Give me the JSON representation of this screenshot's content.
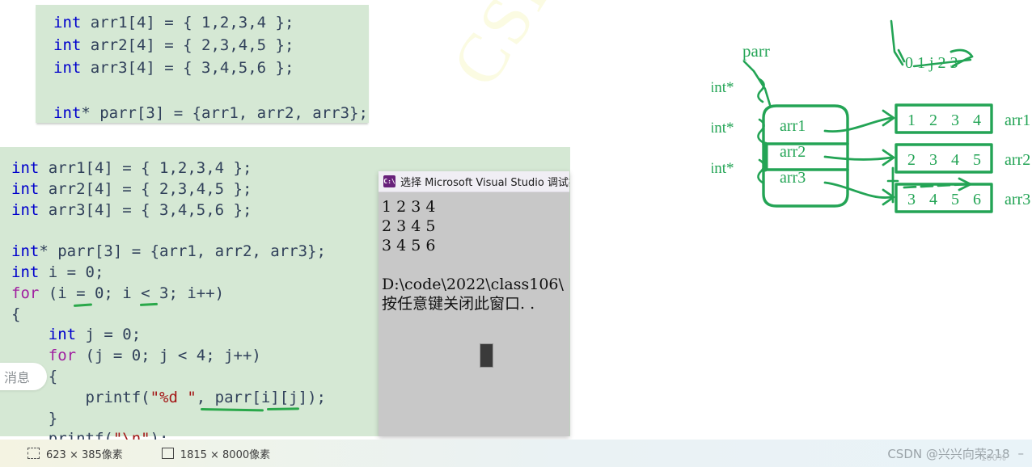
{
  "watermark": {
    "diagonal": "CSDN @兴兴向荣",
    "footer": "CSDN @兴兴向荣218",
    "zoom": "100%",
    "dash": "–"
  },
  "code_top": {
    "lines": [
      {
        "tokens": [
          {
            "t": "int",
            "c": "kw"
          },
          {
            "t": " arr1[4] = { 1,2,3,4 };",
            "c": "pl"
          }
        ]
      },
      {
        "tokens": [
          {
            "t": "int",
            "c": "kw"
          },
          {
            "t": " arr2[4] = { 2,3,4,5 };",
            "c": "pl"
          }
        ]
      },
      {
        "tokens": [
          {
            "t": "int",
            "c": "kw"
          },
          {
            "t": " arr3[4] = { 3,4,5,6 };",
            "c": "pl"
          }
        ]
      },
      {
        "tokens": [
          {
            "t": "",
            "c": "pl"
          }
        ]
      },
      {
        "tokens": [
          {
            "t": "int",
            "c": "kw"
          },
          {
            "t": "* parr[3] = {arr1, arr2, arr3};",
            "c": "pl"
          }
        ]
      }
    ]
  },
  "code_bottom": {
    "lines": [
      {
        "tokens": [
          {
            "t": "int",
            "c": "kw"
          },
          {
            "t": " arr1[4] = { 1,2,3,4 };",
            "c": "pl"
          }
        ]
      },
      {
        "tokens": [
          {
            "t": "int",
            "c": "kw"
          },
          {
            "t": " arr2[4] = { 2,3,4,5 };",
            "c": "pl"
          }
        ]
      },
      {
        "tokens": [
          {
            "t": "int",
            "c": "kw"
          },
          {
            "t": " arr3[4] = { 3,4,5,6 };",
            "c": "pl"
          }
        ]
      },
      {
        "tokens": [
          {
            "t": "",
            "c": "pl"
          }
        ]
      },
      {
        "tokens": [
          {
            "t": "int",
            "c": "kw"
          },
          {
            "t": "* parr[3] = {arr1, arr2, arr3};",
            "c": "pl"
          }
        ]
      },
      {
        "tokens": [
          {
            "t": "int",
            "c": "kw"
          },
          {
            "t": " i = 0;",
            "c": "pl"
          }
        ]
      },
      {
        "tokens": [
          {
            "t": "for",
            "c": "kwctl"
          },
          {
            "t": " (i = 0; i < 3; i++)",
            "c": "pl"
          }
        ]
      },
      {
        "tokens": [
          {
            "t": "{",
            "c": "pl"
          }
        ]
      },
      {
        "tokens": [
          {
            "t": "    ",
            "c": "pl"
          },
          {
            "t": "int",
            "c": "kw"
          },
          {
            "t": " j = 0;",
            "c": "pl"
          }
        ]
      },
      {
        "tokens": [
          {
            "t": "    ",
            "c": "pl"
          },
          {
            "t": "for",
            "c": "kwctl"
          },
          {
            "t": " (j = 0; j < 4; j++)",
            "c": "pl"
          }
        ]
      },
      {
        "tokens": [
          {
            "t": "    {",
            "c": "pl"
          }
        ]
      },
      {
        "tokens": [
          {
            "t": "        printf(",
            "c": "pl"
          },
          {
            "t": "\"%d \"",
            "c": "str"
          },
          {
            "t": ", parr[i][j]);",
            "c": "pl"
          }
        ]
      },
      {
        "tokens": [
          {
            "t": "    }",
            "c": "pl"
          }
        ]
      },
      {
        "tokens": [
          {
            "t": "    printf(",
            "c": "pl"
          },
          {
            "t": "\"\\n\"",
            "c": "str"
          },
          {
            "t": ");",
            "c": "pl"
          }
        ]
      }
    ]
  },
  "message_pill": {
    "label": "消息"
  },
  "console": {
    "title": "选择 Microsoft Visual Studio 调试控",
    "icon": "console-icon",
    "icon_glyph": "C:\\",
    "output_lines": [
      "1 2 3 4",
      "2 3 4 5",
      "3 4 5 6",
      "",
      "D:\\code\\2022\\class106\\",
      "按任意键关闭此窗口. ."
    ]
  },
  "diagram": {
    "stroke_color": "#23a455",
    "parr_label": "parr",
    "pointer_type_labels": [
      "int*",
      "int*",
      "int*"
    ],
    "parr_cells": [
      "arr1",
      "arr2",
      "arr3"
    ],
    "index_scribble": "0 1 j 2 3",
    "arrays": [
      {
        "name": "arr1",
        "values": [
          "1",
          "2",
          "3",
          "4"
        ]
      },
      {
        "name": "arr2",
        "values": [
          "2",
          "3",
          "4",
          "5"
        ]
      },
      {
        "name": "arr3",
        "values": [
          "3",
          "4",
          "5",
          "6"
        ]
      }
    ]
  },
  "statusbar": {
    "selection_size": "623 × 385像素",
    "image_size": "1815 × 8000像素",
    "selection_icon": "selection-icon",
    "image_icon": "image-size-icon"
  }
}
